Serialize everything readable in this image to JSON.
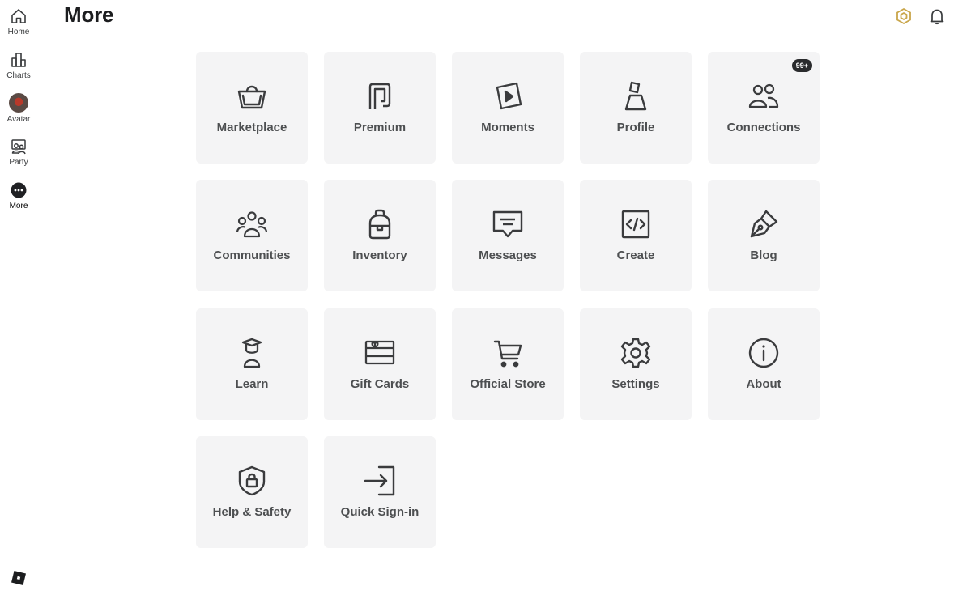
{
  "sidebar": {
    "items": [
      {
        "label": "Home",
        "icon": "home-icon"
      },
      {
        "label": "Charts",
        "icon": "charts-icon"
      },
      {
        "label": "Avatar",
        "icon": "avatar"
      },
      {
        "label": "Party",
        "icon": "party-icon"
      },
      {
        "label": "More",
        "icon": "more-icon"
      }
    ],
    "logo_icon": "roblox-logo"
  },
  "header": {
    "title": "More",
    "robux_icon": "robux-icon",
    "notifications_icon": "bell-icon"
  },
  "tiles": [
    {
      "label": "Marketplace",
      "icon": "shopping-bag-icon"
    },
    {
      "label": "Premium",
      "icon": "premium-icon"
    },
    {
      "label": "Moments",
      "icon": "moments-play-icon"
    },
    {
      "label": "Profile",
      "icon": "profile-icon"
    },
    {
      "label": "Connections",
      "icon": "connections-icon",
      "badge": "99+"
    },
    {
      "label": "Communities",
      "icon": "communities-icon"
    },
    {
      "label": "Inventory",
      "icon": "backpack-icon"
    },
    {
      "label": "Messages",
      "icon": "message-icon"
    },
    {
      "label": "Create",
      "icon": "code-icon"
    },
    {
      "label": "Blog",
      "icon": "pen-icon"
    },
    {
      "label": "Learn",
      "icon": "learn-icon"
    },
    {
      "label": "Gift Cards",
      "icon": "gift-card-icon"
    },
    {
      "label": "Official Store",
      "icon": "cart-icon"
    },
    {
      "label": "Settings",
      "icon": "gear-icon"
    },
    {
      "label": "About",
      "icon": "info-icon"
    },
    {
      "label": "Help & Safety",
      "icon": "shield-lock-icon"
    },
    {
      "label": "Quick Sign-in",
      "icon": "sign-in-icon"
    }
  ]
}
